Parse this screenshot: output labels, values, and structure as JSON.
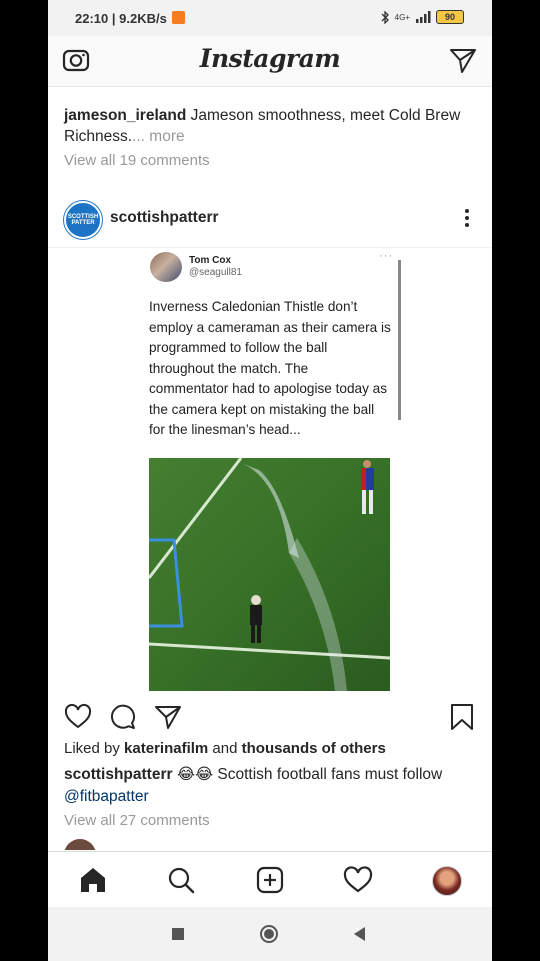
{
  "status_bar": {
    "time": "22:10",
    "rate": "9.2KB/s",
    "network": "4G+",
    "battery": "90"
  },
  "header": {
    "logo": "Instagram",
    "camera_icon": "camera-icon",
    "direct_icon": "direct-message-icon"
  },
  "prev_post": {
    "username": "jameson_ireland",
    "caption": " Jameson smoothness, meet Cold Brew Richness.",
    "more": "... more",
    "view_comments": "View all 19 comments"
  },
  "post": {
    "username": "scottishpatterr",
    "avatar_text": "SCOTTISH PATTER",
    "tweet": {
      "name": "Tom Cox",
      "handle": "@seagull81",
      "dots": "···",
      "text": "Inverness Caledonian Thistle don’t employ a cameraman as their camera is programmed to follow the ball throughout the match. The commentator had to apologise today as the camera kept on mistaking the ball for the linesman’s head..."
    },
    "liked_prefix": "Liked by ",
    "liked_user": "katerinafilm",
    "liked_mid": " and ",
    "liked_rest": "thousands of others",
    "caption_user": "scottishpatterr",
    "caption_emoji": "😂😂",
    "caption_text": " Scottish football fans must follow ",
    "caption_link": "@fitbapatter",
    "view_comments": "View all 27 comments"
  },
  "colors": {
    "link": "#003569",
    "muted": "#999999",
    "pitch": "#3f7a2d",
    "brand_blue": "#1d74c4"
  }
}
